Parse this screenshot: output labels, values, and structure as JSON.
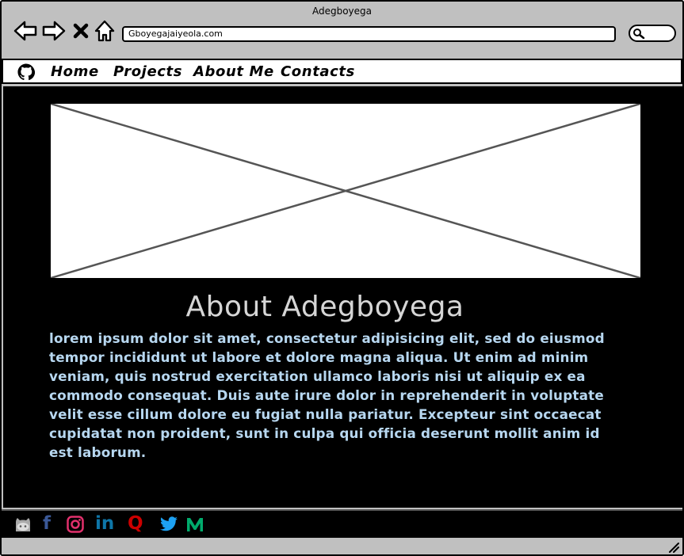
{
  "window": {
    "title": "Adegboyega"
  },
  "toolbar": {
    "url": "Gboyegajaiyeola.com"
  },
  "nav": {
    "links": [
      {
        "label": "Home"
      },
      {
        "label": "Projects"
      },
      {
        "label": "About Me"
      },
      {
        "label": "Contacts"
      }
    ]
  },
  "about": {
    "heading": "About Adegboyega",
    "text": "lorem ipsum dolor sit amet, consectetur adipisicing elit, sed do eiusmod tempor incididunt ut labore et dolore magna aliqua. Ut enim ad minim veniam, quis nostrud exercitation ullamco laboris nisi ut aliquip ex ea commodo consequat. Duis aute irure dolor in reprehenderit in voluptate velit esse cillum dolore eu fugiat nulla pariatur. Excepteur sint occaecat cupidatat non proident, sunt in culpa qui officia deserunt mollit anim id est laborum."
  },
  "footer": {
    "social": [
      {
        "icon": "github-octocat-icon",
        "color": "#aaaaaa"
      },
      {
        "icon": "facebook-icon",
        "text": "f",
        "color": "#3b5998"
      },
      {
        "icon": "instagram-icon",
        "color": "#e1306c"
      },
      {
        "icon": "linkedin-icon",
        "text": "in",
        "color": "#0e76a8"
      },
      {
        "icon": "quora-icon",
        "text": "Q",
        "color": "#cc0000"
      },
      {
        "icon": "twitter-icon",
        "color": "#1da1f2"
      },
      {
        "icon": "medium-icon",
        "color": "#00ab6c"
      }
    ]
  }
}
